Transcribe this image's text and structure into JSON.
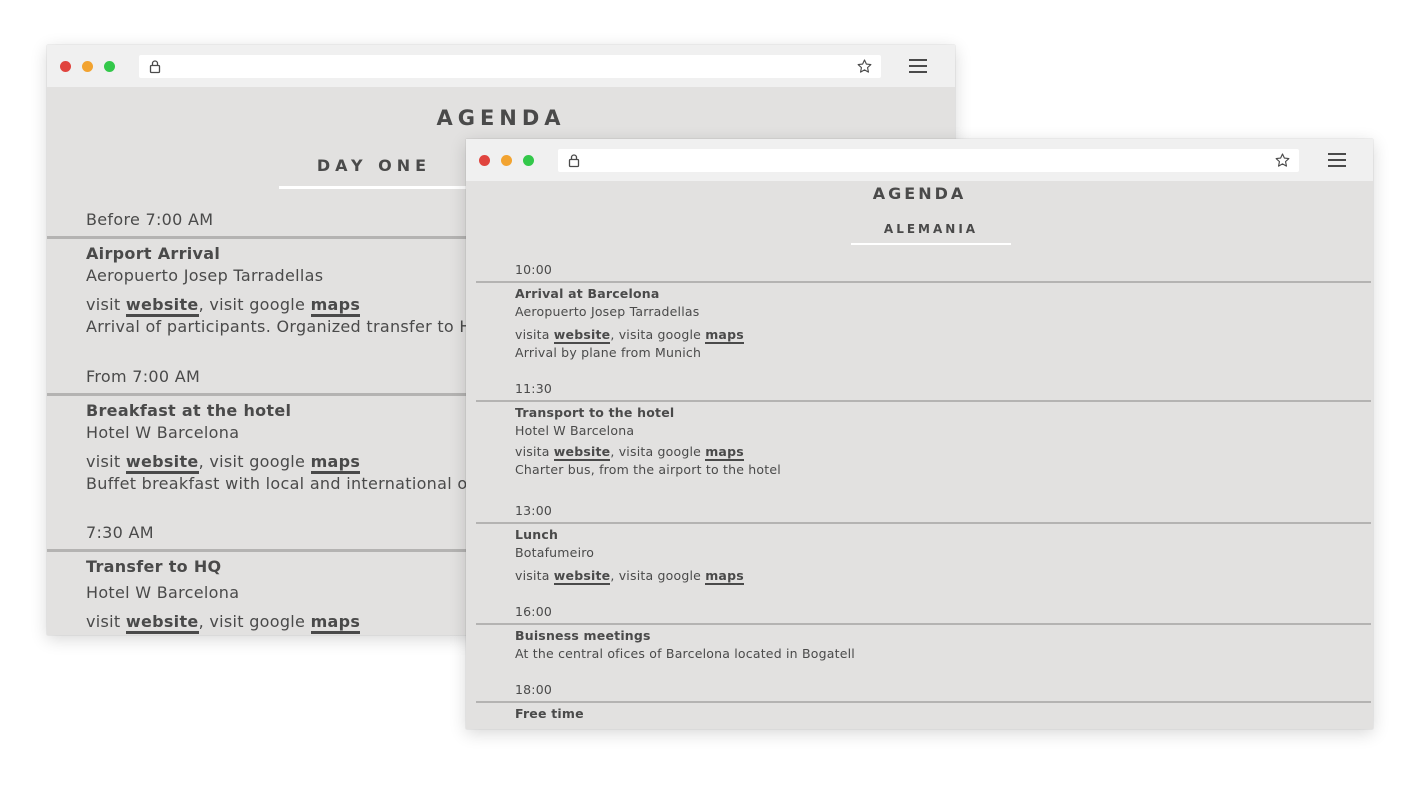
{
  "back_window": {
    "title": "AGENDA",
    "day_title": "DAY ONE",
    "events": [
      {
        "time": "Before 7:00 AM",
        "name": "Airport Arrival",
        "venue": "Aeropuerto Josep Tarradellas",
        "visit_prefix": "visit ",
        "website_label": "website",
        "maps_prefix": ", visit google ",
        "maps_label": "maps",
        "description": "Arrival of participants. Organized transfer to Ho"
      },
      {
        "time": "From 7:00 AM",
        "name": "Breakfast at the hotel",
        "venue": "Hotel W Barcelona",
        "visit_prefix": "visit ",
        "website_label": "website",
        "maps_prefix": ", visit google ",
        "maps_label": "maps",
        "description": "Buffet breakfast with local and international opt"
      },
      {
        "time": "7:30 AM",
        "name": "Transfer to HQ",
        "venue": "Hotel W Barcelona",
        "visit_prefix": "visit ",
        "website_label": "website",
        "maps_prefix": ", visit google ",
        "maps_label": "maps"
      }
    ]
  },
  "front_window": {
    "title": "AGENDA",
    "country_title": "ALEMANIA",
    "events": [
      {
        "time": "10:00",
        "name": "Arrival at Barcelona",
        "venue": "Aeropuerto Josep Tarradellas",
        "visit_prefix": "visita ",
        "website_label": "website",
        "maps_prefix": ", visita google ",
        "maps_label": "maps",
        "description": "Arrival by plane from Munich"
      },
      {
        "time": "11:30",
        "name": "Transport to the hotel",
        "venue": "Hotel W Barcelona",
        "visit_prefix": "visita ",
        "website_label": "website",
        "maps_prefix": ", visita google ",
        "maps_label": "maps",
        "description": "Charter bus, from the airport to the hotel"
      },
      {
        "time": "13:00",
        "name": "Lunch",
        "venue": "Botafumeiro",
        "visit_prefix": "visita ",
        "website_label": "website",
        "maps_prefix": ", visita google ",
        "maps_label": "maps"
      },
      {
        "time": "16:00",
        "name": "Buisness meetings",
        "venue": "At the central ofices of Barcelona located in Bogatell"
      },
      {
        "time": "18:00",
        "name": "Free time"
      }
    ]
  },
  "icons": {
    "traffic_lights": [
      "close-dot",
      "minimize-dot",
      "maximize-dot"
    ],
    "address_bar": [
      "lock-icon",
      "star-icon"
    ],
    "toolbar": [
      "hamburger-menu-icon"
    ]
  },
  "colors": {
    "page_background": "#e2e1e0",
    "chrome_background": "#f0f0f0",
    "text": "#4a4a4a",
    "rule": "#b4b3b2",
    "close": "#e0443e",
    "minimize": "#f2a330",
    "maximize": "#33c84a"
  }
}
